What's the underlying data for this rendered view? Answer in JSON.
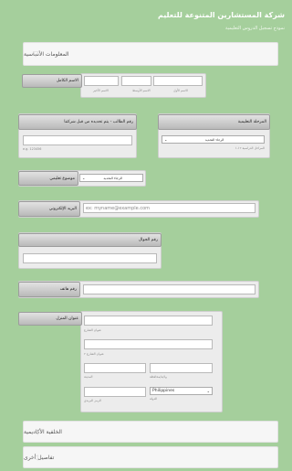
{
  "header": {
    "title": "شركة المستشارين المتنوعة للتعليم",
    "subtitle": "نموذج تسجيل الدروس التعليمية"
  },
  "sections": {
    "basic": "المعلومات الأساسية",
    "academic": "الخلفية الأكاديمية",
    "other": "تفاصيل أخرى"
  },
  "full_name": {
    "label": "الاسم الكامل",
    "first": "الاسم الأول",
    "middle": "الاسم الأوسط",
    "last": "الاسم الأخير"
  },
  "grade": {
    "label": "المرحلة التعليمية",
    "select": "الرجاء التحديد",
    "hint": "المراحل الدراسية ١٢-١"
  },
  "student_id": {
    "label": "رقم الطالب - يتم تحديده من قبل شركتنا",
    "hint": "e.g. 123456"
  },
  "subject": {
    "label": "موضوع تعليمي",
    "select": "الرجاء التحديد"
  },
  "email": {
    "label": "البريد الإلكتروني",
    "placeholder": "ex: myname@example.com"
  },
  "mobile": {
    "label": "رقم الجوال"
  },
  "phone": {
    "label": "رقم هاتف"
  },
  "address": {
    "label": "عنوان المنزل",
    "street1": "عنوان الشارع",
    "street2": "عنوان الشارع ٢",
    "city": "المدينة",
    "state": "ولاية/محافظة",
    "zip": "الرمز البريدي",
    "country_label": "الدولة",
    "country": "Philippines"
  },
  "colors": {
    "background": "#a5cf9c",
    "section_bar": "#f6f6f6",
    "card": "#ececec"
  },
  "icons": {
    "section_toggle": "collapse-triangle-icon",
    "dropdown": "chevron-down-icon"
  }
}
